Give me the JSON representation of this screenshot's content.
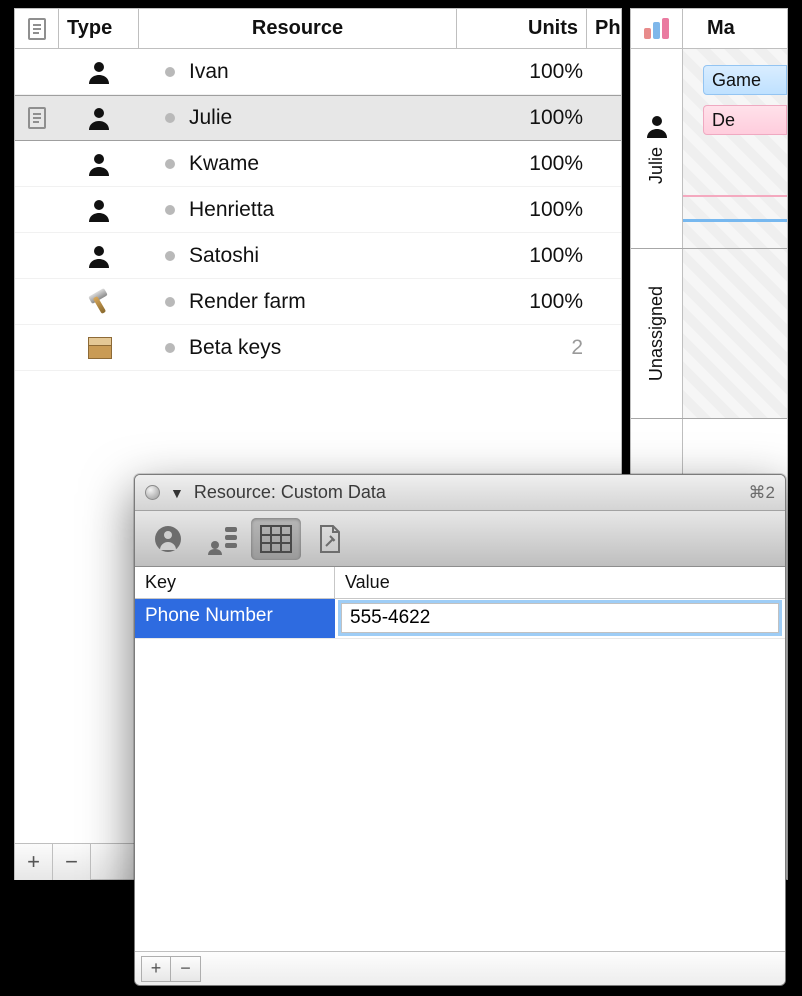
{
  "outline": {
    "headers": {
      "type": "Type",
      "resource": "Resource",
      "units": "Units",
      "phone": "Ph"
    },
    "rows": [
      {
        "icon": "person",
        "name": "Ivan",
        "units": "100%",
        "selected": false
      },
      {
        "icon": "person",
        "name": "Julie",
        "units": "100%",
        "selected": true
      },
      {
        "icon": "person",
        "name": "Kwame",
        "units": "100%",
        "selected": false
      },
      {
        "icon": "person",
        "name": "Henrietta",
        "units": "100%",
        "selected": false
      },
      {
        "icon": "person",
        "name": "Satoshi",
        "units": "100%",
        "selected": false
      },
      {
        "icon": "hammer",
        "name": "Render farm",
        "units": "100%",
        "selected": false
      },
      {
        "icon": "box",
        "name": "Beta keys",
        "units": "2",
        "selected": false,
        "dim": true
      }
    ],
    "footer": {
      "add": "+",
      "remove": "−"
    }
  },
  "right": {
    "header_partial": "Ma",
    "julie_label": "Julie",
    "unassigned_label": "Unassigned",
    "bars": {
      "blue": "Game",
      "pink": "De"
    }
  },
  "inspector": {
    "title": "Resource: Custom Data",
    "shortcut": "⌘2",
    "columns": {
      "key": "Key",
      "value": "Value"
    },
    "row": {
      "key": "Phone Number",
      "value": "555-4622"
    },
    "footer": {
      "add": "+",
      "remove": "−"
    }
  }
}
